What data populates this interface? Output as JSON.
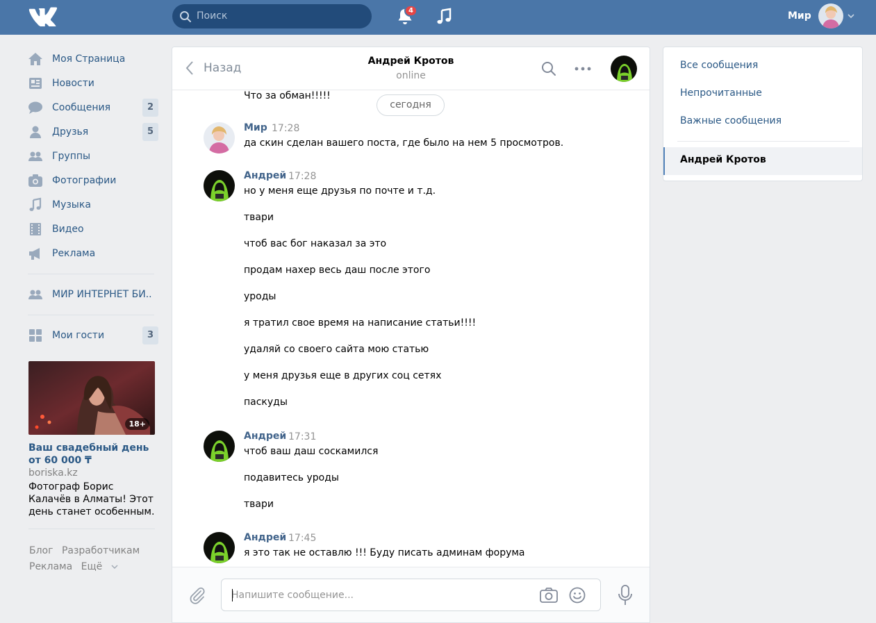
{
  "header": {
    "search_placeholder": "Поиск",
    "notifications_count": "4",
    "user_name": "Мир"
  },
  "nav": {
    "items": [
      {
        "label": "Моя Страница",
        "icon": "home-icon"
      },
      {
        "label": "Новости",
        "icon": "news-icon"
      },
      {
        "label": "Сообщения",
        "icon": "messages-icon",
        "count": "2"
      },
      {
        "label": "Друзья",
        "icon": "friends-icon",
        "count": "5"
      },
      {
        "label": "Группы",
        "icon": "groups-icon"
      },
      {
        "label": "Фотографии",
        "icon": "photos-icon"
      },
      {
        "label": "Музыка",
        "icon": "music-icon"
      },
      {
        "label": "Видео",
        "icon": "video-icon"
      },
      {
        "label": "Реклама",
        "icon": "ads-icon"
      }
    ],
    "community": {
      "label": "МИР ИНТЕРНЕТ БИ..",
      "icon": "community-icon"
    },
    "guests": {
      "label": "Мои гости",
      "icon": "apps-icon",
      "count": "3"
    }
  },
  "ad": {
    "age_badge": "18+",
    "title": "Ваш свадебный день от 60 000 ₸",
    "domain": "boriska.kz",
    "text": "Фотограф Борис Калачёв в Алматы! Этот день станет особенным."
  },
  "footer": {
    "links": [
      "Блог",
      "Разработчикам",
      "Реклама",
      "Ещё"
    ]
  },
  "chat": {
    "back_label": "Назад",
    "peer_name": "Андрей Кротов",
    "peer_status": "online",
    "date_divider": "сегодня",
    "stray_message": "Что за обман!!!!!",
    "groups": [
      {
        "author": "Мир",
        "time": "17:28",
        "avatar": "woman",
        "lines": [
          "да скин сделан вашего поста, где было на нем 5 просмотров."
        ]
      },
      {
        "author": "Андрей",
        "time": "17:28",
        "avatar": "hacker",
        "lines": [
          "но у меня еще друзья по почте и т.д.",
          "твари",
          "чтоб вас бог наказал за это",
          "продам нахер весь даш после этого",
          "уроды",
          "я тратил свое время на написание статьи!!!!",
          "удаляй со своего сайта мою статью",
          "у меня друзья еще в других соц сетях",
          "паскуды"
        ]
      },
      {
        "author": "Андрей",
        "time": "17:31",
        "avatar": "hacker",
        "lines": [
          "чтоб ваш даш соскамился",
          "подавитесь уроды",
          "твари"
        ]
      },
      {
        "author": "Андрей",
        "time": "17:45",
        "avatar": "hacker",
        "lines": [
          "я это так не оставлю !!! Буду писать админам форума"
        ]
      }
    ],
    "composer_placeholder": "Напишите сообщение..."
  },
  "filters": {
    "all": "Все сообщения",
    "unread": "Непрочитанные",
    "important": "Важные сообщения",
    "active_dialog": "Андрей Кротов"
  },
  "colors": {
    "header_bg": "#4a76a8",
    "link": "#2a5885",
    "author": "#42648b",
    "badge": "#e64646",
    "page_bg": "#edeef0"
  }
}
